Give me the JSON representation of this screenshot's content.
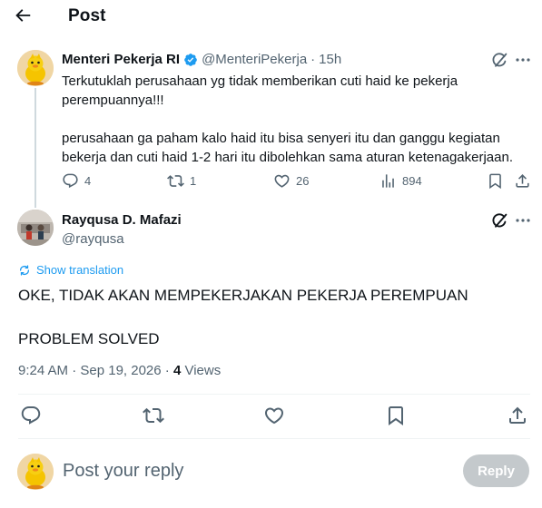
{
  "header": {
    "title": "Post"
  },
  "parent_post": {
    "author_name": "Menteri Pekerja RI",
    "author_handle": "@MenteriPekerja",
    "separator": "·",
    "time": "15h",
    "text_lines": [
      "Terkutuklah perusahaan yg tidak memberikan cuti haid ke pekerja perempuannya!!!",
      "perusahaan ga paham kalo haid itu bisa senyeri itu dan ganggu kegiatan bekerja dan cuti haid 1-2 hari itu dibolehkan sama aturan ketenagakerjaan."
    ],
    "stats": {
      "replies": "4",
      "reposts": "1",
      "likes": "26",
      "views": "894"
    }
  },
  "reply_post": {
    "author_name": "Rayqusa D. Mafazi",
    "author_handle": "@rayqusa",
    "show_translation": "Show translation",
    "text_lines": [
      "OKE, TIDAK AKAN MEMPEKERJAKAN PEKERJA PEREMPUAN",
      "PROBLEM SOLVED"
    ],
    "timestamp": "9:24 AM · Sep 19, 2026 ·",
    "views_count": "4",
    "views_label": "Views"
  },
  "composer": {
    "placeholder": "Post your reply",
    "reply_button": "Reply"
  },
  "colors": {
    "accent": "#1d9bf0",
    "verified": "#1d9bf0",
    "muted": "#536471",
    "border": "#eff3f4",
    "disabled_button": "#c4c9cc"
  },
  "icons": [
    "back-arrow-icon",
    "verified-badge-icon",
    "grok-icon",
    "more-icon",
    "reply-icon",
    "repost-icon",
    "like-icon",
    "views-icon",
    "bookmark-icon",
    "share-icon",
    "translate-icon"
  ]
}
